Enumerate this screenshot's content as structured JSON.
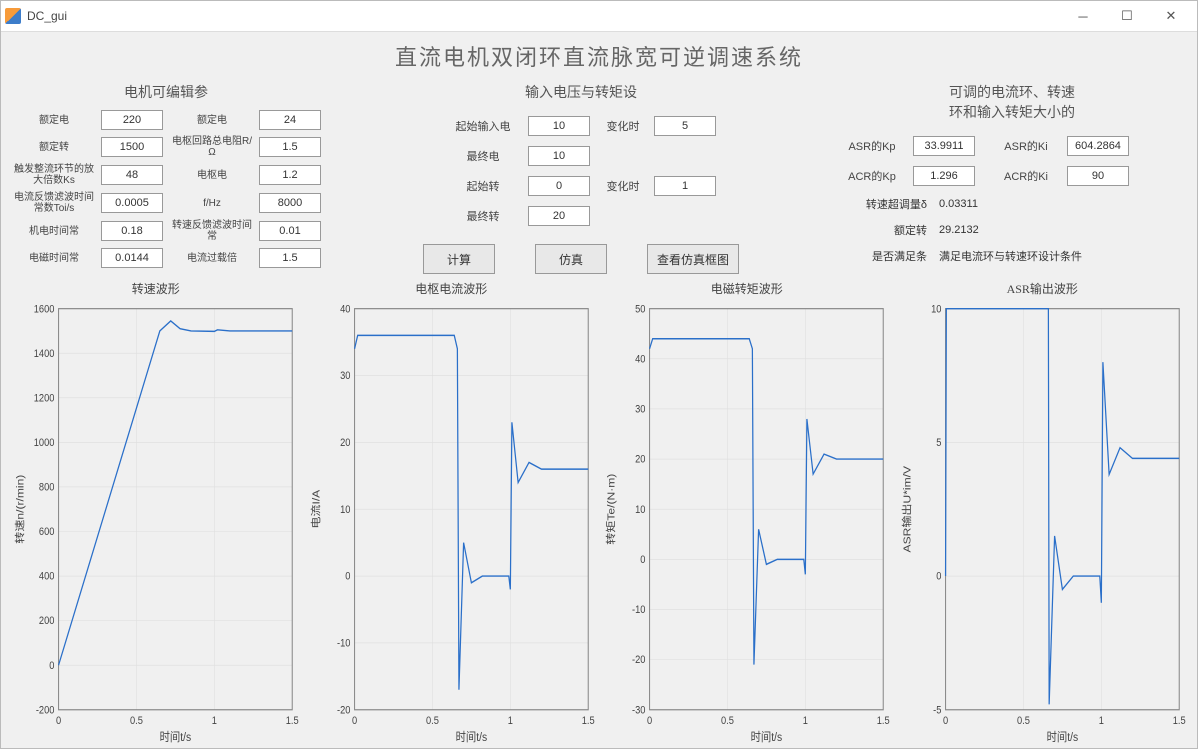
{
  "window": {
    "title": "DC_gui"
  },
  "main_title": "直流电机双闭环直流脉宽可逆调速系统",
  "left": {
    "title": "电机可编辑参",
    "rows": [
      [
        "额定电",
        "220",
        "额定电",
        "24"
      ],
      [
        "额定转",
        "1500",
        "电枢回路总电阻R/Ω",
        "1.5"
      ],
      [
        "触发整流环节的放大倍数Ks",
        "48",
        "电枢电",
        "1.2"
      ],
      [
        "电流反馈滤波时间常数Toi/s",
        "0.0005",
        "f/Hz",
        "8000"
      ],
      [
        "机电时间常",
        "0.18",
        "转速反馈滤波时间常",
        "0.01"
      ],
      [
        "电磁时间常",
        "0.0144",
        "电流过载倍",
        "1.5"
      ]
    ]
  },
  "mid": {
    "title": "输入电压与转矩设",
    "rows": [
      [
        "起始输入电",
        "10",
        "变化时",
        "5"
      ],
      [
        "最终电",
        "10",
        "",
        ""
      ],
      [
        "起始转",
        "0",
        "变化时",
        "1"
      ],
      [
        "最终转",
        "20",
        "",
        ""
      ]
    ],
    "buttons": [
      "计算",
      "仿真",
      "查看仿真框图"
    ]
  },
  "right": {
    "title": "可调的电流环、转速\n环和输入转矩大小的",
    "rows": [
      [
        "ASR的Kp",
        "33.9911",
        "ASR的Ki",
        "604.2864"
      ],
      [
        "ACR的Kp",
        "1.296",
        "ACR的Ki",
        "90"
      ]
    ],
    "extras": [
      [
        "转速超调量δ",
        "0.03311"
      ],
      [
        "额定转",
        "29.2132"
      ],
      [
        "是否满足条",
        "满足电流环与转速环设计条件"
      ]
    ]
  },
  "chart_data": [
    {
      "title": "转速波形",
      "xlabel": "时间t/s",
      "ylabel": "转速n/(r/min)",
      "xlim": [
        0,
        1.5
      ],
      "ylim": [
        -200,
        1600
      ],
      "yticks": [
        -200,
        0,
        200,
        400,
        600,
        800,
        1000,
        1200,
        1400,
        1600
      ],
      "xticks": [
        0,
        0.5,
        1,
        1.5
      ],
      "series": [
        [
          0,
          0
        ],
        [
          0.65,
          1500
        ],
        [
          0.72,
          1545
        ],
        [
          0.78,
          1510
        ],
        [
          0.85,
          1500
        ],
        [
          1.0,
          1498
        ],
        [
          1.02,
          1505
        ],
        [
          1.1,
          1500
        ],
        [
          1.5,
          1500
        ]
      ]
    },
    {
      "title": "电枢电流波形",
      "xlabel": "时间t/s",
      "ylabel": "电流I/A",
      "xlim": [
        0,
        1.5
      ],
      "ylim": [
        -20,
        40
      ],
      "yticks": [
        -20,
        -10,
        0,
        10,
        20,
        30,
        40
      ],
      "xticks": [
        0,
        0.5,
        1,
        1.5
      ],
      "series": [
        [
          0,
          34
        ],
        [
          0.02,
          36
        ],
        [
          0.64,
          36
        ],
        [
          0.66,
          34
        ],
        [
          0.67,
          -17
        ],
        [
          0.7,
          5
        ],
        [
          0.75,
          -1
        ],
        [
          0.82,
          0
        ],
        [
          0.99,
          0
        ],
        [
          1.0,
          -2
        ],
        [
          1.01,
          23
        ],
        [
          1.05,
          14
        ],
        [
          1.12,
          17
        ],
        [
          1.2,
          16
        ],
        [
          1.5,
          16
        ]
      ]
    },
    {
      "title": "电磁转矩波形",
      "xlabel": "时间t/s",
      "ylabel": "转矩Te/(N·m)",
      "xlim": [
        0,
        1.5
      ],
      "ylim": [
        -30,
        50
      ],
      "yticks": [
        -30,
        -20,
        -10,
        0,
        10,
        20,
        30,
        40,
        50
      ],
      "xticks": [
        0,
        0.5,
        1,
        1.5
      ],
      "series": [
        [
          0,
          42
        ],
        [
          0.02,
          44
        ],
        [
          0.64,
          44
        ],
        [
          0.66,
          42
        ],
        [
          0.67,
          -21
        ],
        [
          0.7,
          6
        ],
        [
          0.75,
          -1
        ],
        [
          0.82,
          0
        ],
        [
          0.99,
          0
        ],
        [
          1.0,
          -3
        ],
        [
          1.01,
          28
        ],
        [
          1.05,
          17
        ],
        [
          1.12,
          21
        ],
        [
          1.2,
          20
        ],
        [
          1.5,
          20
        ]
      ]
    },
    {
      "title": "ASR输出波形",
      "xlabel": "时间t/s",
      "ylabel": "ASR输出U*im/V",
      "xlim": [
        0,
        1.5
      ],
      "ylim": [
        -5,
        10
      ],
      "yticks": [
        -5,
        0,
        5,
        10
      ],
      "xticks": [
        0,
        0.5,
        1,
        1.5
      ],
      "series": [
        [
          0,
          0
        ],
        [
          0.005,
          10
        ],
        [
          0.64,
          10
        ],
        [
          0.66,
          10
        ],
        [
          0.665,
          -4.8
        ],
        [
          0.7,
          1.5
        ],
        [
          0.75,
          -0.5
        ],
        [
          0.82,
          0
        ],
        [
          0.99,
          0
        ],
        [
          1.0,
          -1
        ],
        [
          1.01,
          8
        ],
        [
          1.05,
          3.8
        ],
        [
          1.12,
          4.8
        ],
        [
          1.2,
          4.4
        ],
        [
          1.5,
          4.4
        ]
      ]
    }
  ]
}
